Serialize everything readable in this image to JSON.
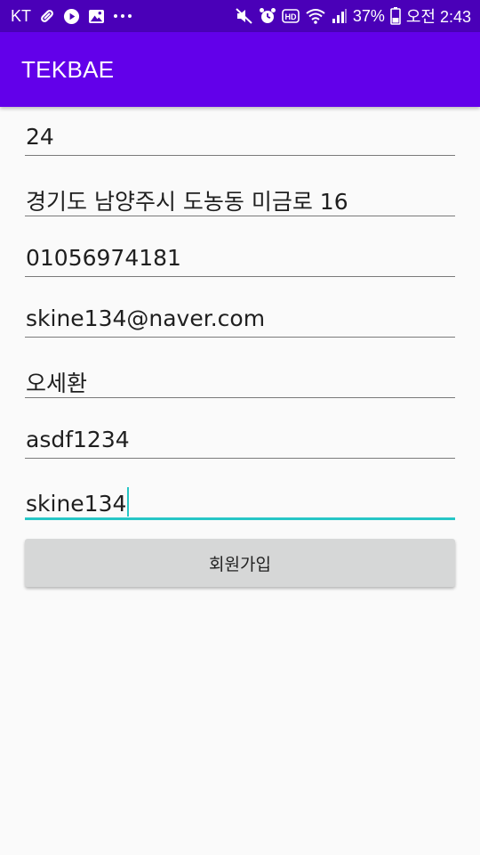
{
  "status_bar": {
    "carrier": "KT",
    "battery": "37%",
    "time": "오전 2:43",
    "left_icons": [
      "link-icon",
      "play-icon",
      "image-icon",
      "more-dots-icon"
    ],
    "right_icons": [
      "mute-icon",
      "alarm-icon",
      "hd-icon",
      "wifi-icon",
      "signal-icon",
      "battery-icon"
    ]
  },
  "app_bar": {
    "title": "TEKBAE",
    "color": "#6200ea"
  },
  "form": {
    "fields": [
      {
        "value": "24"
      },
      {
        "value": "경기도 남양주시 도농동 미금로 16"
      },
      {
        "value": "01056974181"
      },
      {
        "value": "skine134@naver.com"
      },
      {
        "value": "오세환"
      },
      {
        "value": "asdf1234"
      },
      {
        "value": "skine134",
        "focused": true
      }
    ],
    "submit_label": "회원가입",
    "accent_color": "#26c6c6"
  }
}
